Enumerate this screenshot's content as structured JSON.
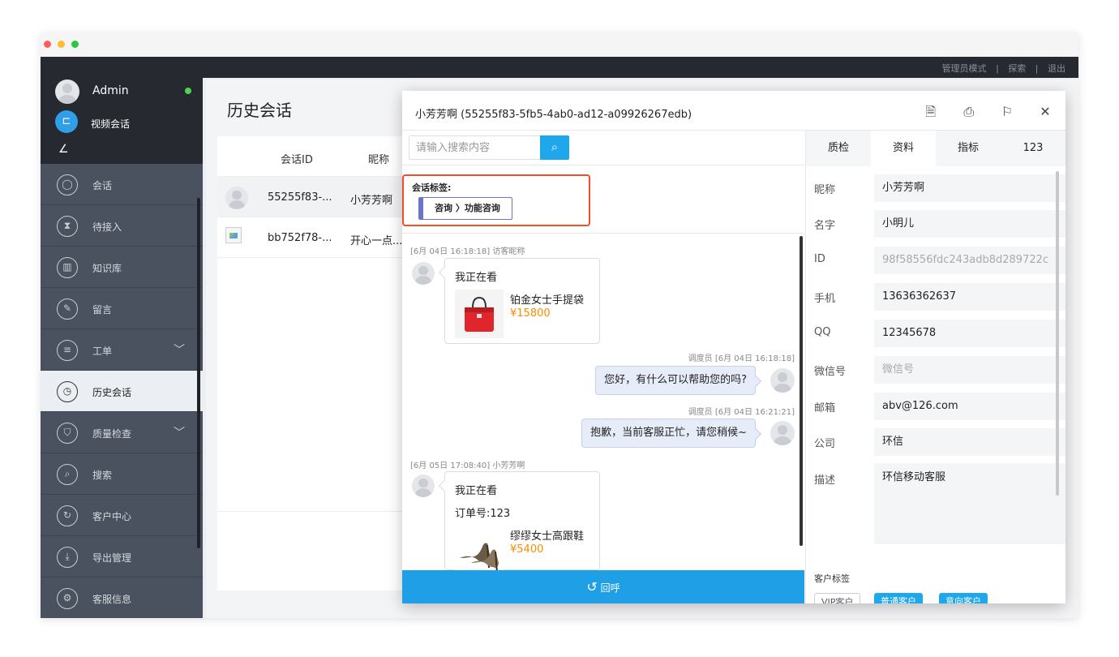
{
  "window": {
    "traffic_lights": [
      "#ff5f57",
      "#febc2e",
      "#28c840"
    ]
  },
  "topbar": {
    "links": [
      "管理员模式",
      "|",
      "探索",
      "|",
      "退出"
    ]
  },
  "sidebar": {
    "user_name": "Admin",
    "status_color": "#4fd34f",
    "video_label": "视频会话",
    "collapse_icon": "collapse-icon",
    "items": [
      {
        "label": "会话",
        "icon": "chat-icon",
        "glyph": "◯"
      },
      {
        "label": "待接入",
        "icon": "hourglass-icon",
        "glyph": "⧗"
      },
      {
        "label": "知识库",
        "icon": "book-icon",
        "glyph": "▥"
      },
      {
        "label": "留言",
        "icon": "note-icon",
        "glyph": "✎"
      },
      {
        "label": "工单",
        "icon": "ticket-icon",
        "glyph": "≡",
        "chevron": "﹀"
      },
      {
        "label": "历史会话",
        "icon": "history-icon",
        "glyph": "◷",
        "active": true
      },
      {
        "label": "质量检查",
        "icon": "shield-icon",
        "glyph": "⛉",
        "chevron": "﹀"
      },
      {
        "label": "搜索",
        "icon": "search-icon",
        "glyph": "⌕"
      },
      {
        "label": "客户中心",
        "icon": "customer-icon",
        "glyph": "↻"
      },
      {
        "label": "导出管理",
        "icon": "download-icon",
        "glyph": "⤓"
      },
      {
        "label": "客服信息",
        "icon": "settings-icon",
        "glyph": "⚙"
      }
    ]
  },
  "main": {
    "title": "历史会话",
    "table": {
      "headers": {
        "id": "会话ID",
        "nick": "昵称"
      },
      "rows": [
        {
          "id": "55255f83-...",
          "nick": "小芳芳啊"
        },
        {
          "id": "bb752f78-...",
          "nick": "开心一点..."
        }
      ]
    }
  },
  "dialog": {
    "title": "小芳芳啊 (55255f83-5fb5-4ab0-ad12-a09926267edb)",
    "icons": [
      {
        "name": "document-icon",
        "glyph": "🗎"
      },
      {
        "name": "print-icon",
        "glyph": "⎙"
      },
      {
        "name": "flag-icon",
        "glyph": "⚐"
      },
      {
        "name": "close-icon",
        "glyph": "✕"
      }
    ],
    "search_placeholder": "请输入搜索内容",
    "search_icon": "search-icon",
    "tag_label": "会话标签:",
    "tag_value": "咨询 〉功能咨询",
    "messages": {
      "m1_meta": "[6月 04日 16:18:18] 访客昵称",
      "m1_text": "我正在看",
      "m1_product": "铂金女士手提袋",
      "m1_price": "¥15800",
      "m2_meta": "调度员 [6月 04日 16:18:18]",
      "m2_text": "您好，有什么可以帮助您的吗?",
      "m3_meta": "调度员 [6月 04日 16:21:21]",
      "m3_text": "抱歉，当前客服正忙，请您稍候~",
      "m4_meta": "[6月 05日 17:08:40] 小芳芳啊",
      "m4_text": "我正在看",
      "m4_order": "订单号:123",
      "m4_product": "缪缪女士高跟鞋",
      "m4_price": "¥5400"
    },
    "callback_label": "回呼",
    "callback_icon": "callback-icon",
    "tabs": [
      "质检",
      "资料",
      "指标",
      "123"
    ],
    "active_tab": 1,
    "fields": [
      {
        "label": "昵称",
        "value": "小芳芳啊"
      },
      {
        "label": "名字",
        "value": "小明儿"
      },
      {
        "label": "ID",
        "value": "98f58556fdc243adb8d289722c",
        "placeholder": true
      },
      {
        "label": "手机",
        "value": "13636362637"
      },
      {
        "label": "QQ",
        "value": "12345678"
      },
      {
        "label": "微信号",
        "value": "微信号",
        "placeholder": true
      },
      {
        "label": "邮箱",
        "value": "abv@126.com"
      },
      {
        "label": "公司",
        "value": "环信"
      },
      {
        "label": "描述",
        "value": "环信移动客服"
      }
    ],
    "customer_tag_label": "客户标签",
    "customer_tags": [
      "VIP客户",
      "普通客户",
      "意向客户"
    ],
    "accent": "#1ea7ea"
  }
}
